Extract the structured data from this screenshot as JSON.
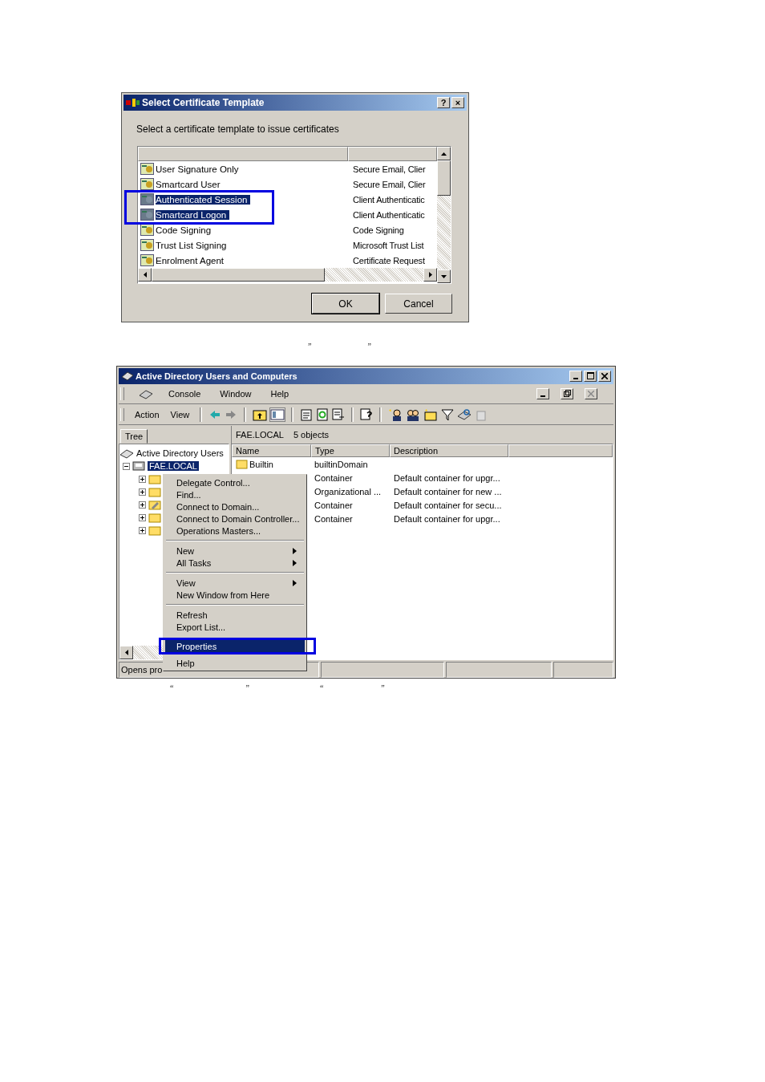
{
  "certificate_dialog": {
    "title": "Select Certificate Template",
    "help_button": "?",
    "close_button": "×",
    "instruction": "Select a certificate template to issue certificates",
    "templates": [
      {
        "name": "User Signature Only",
        "purpose": "Secure Email, Clier",
        "selected": false
      },
      {
        "name": "Smartcard User",
        "purpose": "Secure Email, Clier",
        "selected": false
      },
      {
        "name": "Authenticated Session",
        "purpose": "Client Authenticatic",
        "selected": true
      },
      {
        "name": "Smartcard Logon",
        "purpose": "Client Authenticatic",
        "selected": true
      },
      {
        "name": "Code Signing",
        "purpose": "Code Signing",
        "selected": false
      },
      {
        "name": "Trust List Signing",
        "purpose": "Microsoft Trust List",
        "selected": false
      },
      {
        "name": "Enrolment Agent",
        "purpose": "Certificate Request",
        "selected": false
      }
    ],
    "buttons": [
      "OK",
      "Cancel"
    ]
  },
  "caption_1": [
    "”",
    "”"
  ],
  "ad_window": {
    "title": "Active Directory Users and Computers",
    "menu": [
      "Console",
      "Window",
      "Help"
    ],
    "action_menu": [
      "Action",
      "View"
    ],
    "tree_tab": "Tree",
    "location": "FAE.LOCAL",
    "object_count": "5 objects",
    "tree": [
      {
        "label": "Active Directory Users",
        "children": [
          {
            "label": "FAE.LOCAL",
            "selected": true,
            "expanded": true,
            "children": [
              {
                "kind": "folder",
                "expanded": false
              },
              {
                "kind": "folder",
                "expanded": false
              },
              {
                "kind": "ou",
                "expanded": false
              },
              {
                "kind": "folder",
                "expanded": false
              },
              {
                "kind": "folder",
                "expanded": false
              }
            ]
          }
        ]
      }
    ],
    "columns": [
      "Name",
      "Type",
      "Description"
    ],
    "rows": [
      {
        "name": "Builtin",
        "type": "builtinDomain"
      },
      {
        "type": "Container",
        "description": "Default container for upgr..."
      },
      {
        "type": "Organizational ...",
        "description": "Default container for new ..."
      },
      {
        "type": "Container",
        "description": "Default container for secu..."
      },
      {
        "type": "Container",
        "description": "Default container for upgr..."
      }
    ],
    "status": "Opens pro",
    "context_menu": [
      [
        {
          "label": "Delegate Control...",
          "submenu": false,
          "selected": false
        },
        {
          "label": "Find...",
          "submenu": false,
          "selected": false
        },
        {
          "label": "Connect to Domain...",
          "submenu": false,
          "selected": false
        },
        {
          "label": "Connect to Domain Controller...",
          "submenu": false,
          "selected": false
        },
        {
          "label": "Operations Masters...",
          "submenu": false,
          "selected": false
        }
      ],
      [
        {
          "label": "New",
          "submenu": true,
          "selected": false
        },
        {
          "label": "All Tasks",
          "submenu": true,
          "selected": false
        }
      ],
      [
        {
          "label": "View",
          "submenu": true,
          "selected": false
        },
        {
          "label": "New Window from Here",
          "submenu": false,
          "selected": false
        }
      ],
      [
        {
          "label": "Refresh",
          "submenu": false,
          "selected": false
        },
        {
          "label": "Export List...",
          "submenu": false,
          "selected": false
        }
      ],
      [
        {
          "label": "Properties",
          "submenu": false,
          "selected": true
        }
      ],
      [
        {
          "label": "Help",
          "submenu": false,
          "selected": false
        }
      ]
    ]
  },
  "caption_2": [
    "“",
    "”",
    "“",
    "”"
  ]
}
